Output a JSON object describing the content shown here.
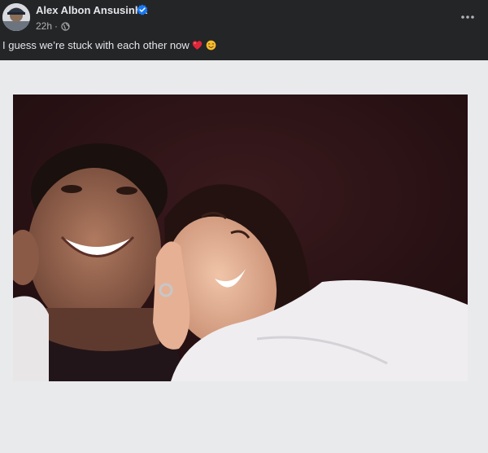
{
  "post": {
    "author_name": "Alex Albon Ansusinha",
    "time": "22h",
    "separator": "·",
    "audience_icon": "globe-icon",
    "verified_icon": "verified-badge-icon",
    "more_icon": "more-options-icon",
    "text": "I guess we’re stuck with each other now",
    "emojis": [
      "red-heart",
      "smiling-face"
    ],
    "photo_icon": "photo"
  },
  "colors": {
    "background": "#242526",
    "primary_text": "#e4e6eb",
    "secondary_text": "#b0b3b8",
    "verified_blue": "#1877f2",
    "photo_frame": "#e8eaec"
  }
}
